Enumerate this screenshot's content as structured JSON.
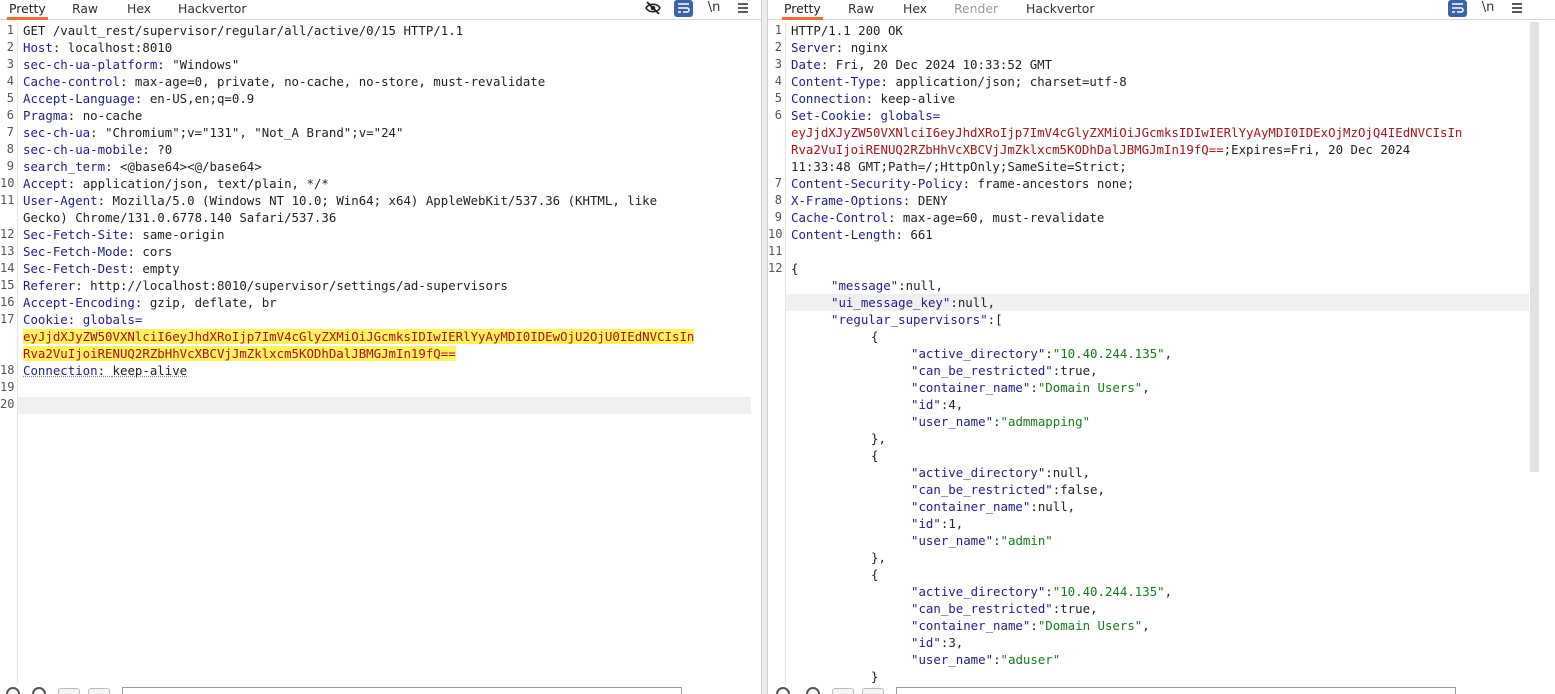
{
  "request": {
    "tabs": [
      "Pretty",
      "Raw",
      "Hex",
      "Hackvertor"
    ],
    "active_tab": "Pretty",
    "toolbar": {
      "wrap_icon": "word-wrap-icon",
      "newline_label": "\\n",
      "menu_icon": "hamburger-icon",
      "hide_icon": "eye-slash-icon"
    },
    "lines": [
      {
        "n": "1",
        "text": "GET /vault_rest/supervisor/regular/all/active/0/15 HTTP/1.1"
      },
      {
        "n": "2",
        "key": "Host",
        "value": "localhost:8010"
      },
      {
        "n": "3",
        "key": "sec-ch-ua-platform",
        "value": "\"Windows\""
      },
      {
        "n": "4",
        "key": "Cache-control",
        "value": "max-age=0, private, no-cache, no-store, must-revalidate"
      },
      {
        "n": "5",
        "key": "Accept-Language",
        "value": "en-US,en;q=0.9"
      },
      {
        "n": "6",
        "key": "Pragma",
        "value": "no-cache"
      },
      {
        "n": "7",
        "key": "sec-ch-ua",
        "value": "\"Chromium\";v=\"131\", \"Not_A Brand\";v=\"24\""
      },
      {
        "n": "8",
        "key": "sec-ch-ua-mobile",
        "value": "?0"
      },
      {
        "n": "9",
        "key": "search_term",
        "value": "<@base64><@/base64>"
      },
      {
        "n": "10",
        "key": "Accept",
        "value": "application/json, text/plain, */*"
      },
      {
        "n": "11",
        "key": "User-Agent",
        "value": "Mozilla/5.0 (Windows NT 10.0; Win64; x64) AppleWebKit/537.36 (KHTML, like"
      },
      {
        "n": "",
        "text": "Gecko) Chrome/131.0.6778.140 Safari/537.36"
      },
      {
        "n": "12",
        "key": "Sec-Fetch-Site",
        "value": "same-origin"
      },
      {
        "n": "13",
        "key": "Sec-Fetch-Mode",
        "value": "cors"
      },
      {
        "n": "14",
        "key": "Sec-Fetch-Dest",
        "value": "empty"
      },
      {
        "n": "15",
        "key": "Referer",
        "value": "http://localhost:8010/supervisor/settings/ad-supervisors"
      },
      {
        "n": "16",
        "key": "Accept-Encoding",
        "value": "gzip, deflate, br"
      },
      {
        "n": "17",
        "key": "Cookie",
        "value": "globals="
      },
      {
        "n": "",
        "cookie": "eyJjdXJyZW50VXNlciI6eyJhdXRoIjp7ImV4cGlyZXMiOiJGcmksIDIwIERlYyAyMDI0IDEwOjU2OjU0IEdNVCIsIn"
      },
      {
        "n": "",
        "cookie": "Rva2VuIjoiRENUQ2RZbHhVcXBCVjJmZklxcm5KODhDalJBMGJmIn19fQ=="
      },
      {
        "n": "18",
        "key": "Connection",
        "value": "keep-alive"
      },
      {
        "n": "19",
        "text": ""
      },
      {
        "n": "20",
        "text": ""
      }
    ]
  },
  "response": {
    "tabs": [
      "Pretty",
      "Raw",
      "Hex",
      "Render",
      "Hackvertor"
    ],
    "active_tab": "Pretty",
    "disabled_tab": "Render",
    "toolbar": {
      "wrap_icon": "word-wrap-icon",
      "newline_label": "\\n",
      "menu_icon": "hamburger-icon"
    },
    "headers": [
      {
        "n": "1",
        "text": "HTTP/1.1 200 OK"
      },
      {
        "n": "2",
        "key": "Server",
        "value": "nginx"
      },
      {
        "n": "3",
        "key": "Date",
        "value": "Fri, 20 Dec 2024 10:33:52 GMT"
      },
      {
        "n": "4",
        "key": "Content-Type",
        "value": "application/json; charset=utf-8"
      },
      {
        "n": "5",
        "key": "Connection",
        "value": "keep-alive"
      },
      {
        "n": "6",
        "key": "Set-Cookie",
        "value": "globals="
      },
      {
        "n": "",
        "cookie": "eyJjdXJyZW50VXNlciI6eyJhdXRoIjp7ImV4cGlyZXMiOiJGcmksIDIwIERlYyAyMDI0IDExOjMzOjQ4IEdNVCIsIn"
      },
      {
        "n": "",
        "cookie": "Rva2VuIjoiRENUQ2RZbHhVcXBCVjJmZklxcm5KODhDalJBMGJmIn19fQ==",
        "tail": ";Expires=Fri, 20 Dec 2024"
      },
      {
        "n": "",
        "text": "11:33:48 GMT;Path=/;HttpOnly;SameSite=Strict;"
      },
      {
        "n": "7",
        "key": "Content-Security-Policy",
        "value": "frame-ancestors none;"
      },
      {
        "n": "8",
        "key": "X-Frame-Options",
        "value": "DENY"
      },
      {
        "n": "9",
        "key": "Cache-Control",
        "value": "max-age=60, must-revalidate"
      },
      {
        "n": "10",
        "key": "Content-Length",
        "value": "661"
      },
      {
        "n": "11",
        "text": ""
      },
      {
        "n": "12",
        "text": "{"
      }
    ],
    "json_lines": [
      {
        "indent": 1,
        "key": "\"message\"",
        "val": "null",
        "valtype": "lit",
        "trail": ","
      },
      {
        "indent": 1,
        "key": "\"ui_message_key\"",
        "val": "null",
        "valtype": "lit",
        "trail": ","
      },
      {
        "indent": 1,
        "key": "\"regular_supervisors\"",
        "val": "[",
        "valtype": "lit",
        "trail": ""
      },
      {
        "indent": 2,
        "punct": "{"
      },
      {
        "indent": 3,
        "key": "\"active_directory\"",
        "val": "\"10.40.244.135\"",
        "valtype": "str",
        "trail": ","
      },
      {
        "indent": 3,
        "key": "\"can_be_restricted\"",
        "val": "true",
        "valtype": "lit",
        "trail": ","
      },
      {
        "indent": 3,
        "key": "\"container_name\"",
        "val": "\"Domain Users\"",
        "valtype": "str",
        "trail": ","
      },
      {
        "indent": 3,
        "key": "\"id\"",
        "val": "4",
        "valtype": "lit",
        "trail": ","
      },
      {
        "indent": 3,
        "key": "\"user_name\"",
        "val": "\"admmapping\"",
        "valtype": "str",
        "trail": ""
      },
      {
        "indent": 2,
        "punct": "},"
      },
      {
        "indent": 2,
        "punct": "{"
      },
      {
        "indent": 3,
        "key": "\"active_directory\"",
        "val": "null",
        "valtype": "lit",
        "trail": ","
      },
      {
        "indent": 3,
        "key": "\"can_be_restricted\"",
        "val": "false",
        "valtype": "lit",
        "trail": ","
      },
      {
        "indent": 3,
        "key": "\"container_name\"",
        "val": "null",
        "valtype": "lit",
        "trail": ","
      },
      {
        "indent": 3,
        "key": "\"id\"",
        "val": "1",
        "valtype": "lit",
        "trail": ","
      },
      {
        "indent": 3,
        "key": "\"user_name\"",
        "val": "\"admin\"",
        "valtype": "str",
        "trail": ""
      },
      {
        "indent": 2,
        "punct": "},"
      },
      {
        "indent": 2,
        "punct": "{"
      },
      {
        "indent": 3,
        "key": "\"active_directory\"",
        "val": "\"10.40.244.135\"",
        "valtype": "str",
        "trail": ","
      },
      {
        "indent": 3,
        "key": "\"can_be_restricted\"",
        "val": "true",
        "valtype": "lit",
        "trail": ","
      },
      {
        "indent": 3,
        "key": "\"container_name\"",
        "val": "\"Domain Users\"",
        "valtype": "str",
        "trail": ","
      },
      {
        "indent": 3,
        "key": "\"id\"",
        "val": "3",
        "valtype": "lit",
        "trail": ","
      },
      {
        "indent": 3,
        "key": "\"user_name\"",
        "val": "\"aduser\"",
        "valtype": "str",
        "trail": ""
      },
      {
        "indent": 2,
        "punct": "}"
      }
    ]
  },
  "colors": {
    "accent_tab": "#ff6633",
    "header_key": "#1e1e8a",
    "string_value": "#1a7a1a",
    "cookie_value": "#a8141a",
    "highlight": "#fff25e",
    "wrap_button": "#3b64a8"
  }
}
